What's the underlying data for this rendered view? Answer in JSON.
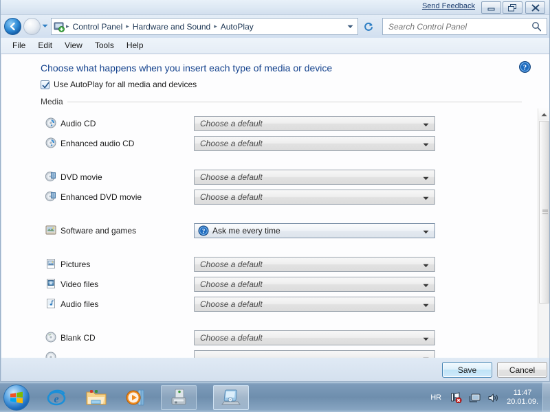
{
  "window": {
    "send_feedback": "Send Feedback",
    "minimize_label": "Minimize",
    "maximize_label": "Maximize",
    "close_label": "Close"
  },
  "address_bar": {
    "breadcrumbs": [
      "Control Panel",
      "Hardware and Sound",
      "AutoPlay"
    ],
    "separator": "▶",
    "icon": "control-panel-icon",
    "dropdown_icon": "chevron-down-icon",
    "refresh_icon": "refresh-icon",
    "back_icon": "back-arrow-icon",
    "forward_icon": "forward-arrow-icon"
  },
  "search": {
    "placeholder": "Search Control Panel",
    "value": "",
    "icon": "search-icon"
  },
  "menu": {
    "items": [
      "File",
      "Edit",
      "View",
      "Tools",
      "Help"
    ]
  },
  "content": {
    "page_title": "Choose what happens when you insert each type of media or device",
    "help_icon": "help-icon",
    "checkbox": {
      "label": "Use AutoPlay for all media and devices",
      "checked": true
    },
    "group_label": "Media",
    "default_option": "Choose a default",
    "rows": [
      {
        "label": "Audio CD",
        "icon": "audio-cd-icon",
        "value": "Choose a default",
        "chosen": false,
        "gap": false
      },
      {
        "label": "Enhanced audio CD",
        "icon": "audio-cd-icon",
        "value": "Choose a default",
        "chosen": false,
        "gap": false
      },
      {
        "label": "DVD movie",
        "icon": "dvd-movie-icon",
        "value": "Choose a default",
        "chosen": false,
        "gap": true
      },
      {
        "label": "Enhanced DVD movie",
        "icon": "dvd-movie-icon",
        "value": "Choose a default",
        "chosen": false,
        "gap": false
      },
      {
        "label": "Software and games",
        "icon": "software-games-icon",
        "value": "Ask me every time",
        "chosen": true,
        "gap": true
      },
      {
        "label": "Pictures",
        "icon": "pictures-icon",
        "value": "Choose a default",
        "chosen": false,
        "gap": true
      },
      {
        "label": "Video files",
        "icon": "video-files-icon",
        "value": "Choose a default",
        "chosen": false,
        "gap": false
      },
      {
        "label": "Audio files",
        "icon": "audio-files-icon",
        "value": "Choose a default",
        "chosen": false,
        "gap": false
      },
      {
        "label": "Blank CD",
        "icon": "blank-cd-icon",
        "value": "Choose a default",
        "chosen": false,
        "gap": true
      },
      {
        "label": "",
        "icon": "blank-dvd-icon",
        "value": "",
        "chosen": false,
        "gap": false
      }
    ]
  },
  "footer": {
    "save_label": "Save",
    "cancel_label": "Cancel"
  },
  "taskbar": {
    "start_label": "Start",
    "items": [
      {
        "name": "internet-explorer",
        "kind": "pinned"
      },
      {
        "name": "windows-explorer",
        "kind": "pinned"
      },
      {
        "name": "windows-media-player",
        "kind": "pinned"
      },
      {
        "name": "device-window",
        "kind": "window"
      },
      {
        "name": "autoplay-window",
        "kind": "window-active"
      }
    ],
    "tray": {
      "language": "HR",
      "network_icon": "network-error-icon",
      "monitor_icon": "display-icon",
      "volume_icon": "volume-icon",
      "time": "11:47",
      "date": "20.01.09."
    }
  }
}
